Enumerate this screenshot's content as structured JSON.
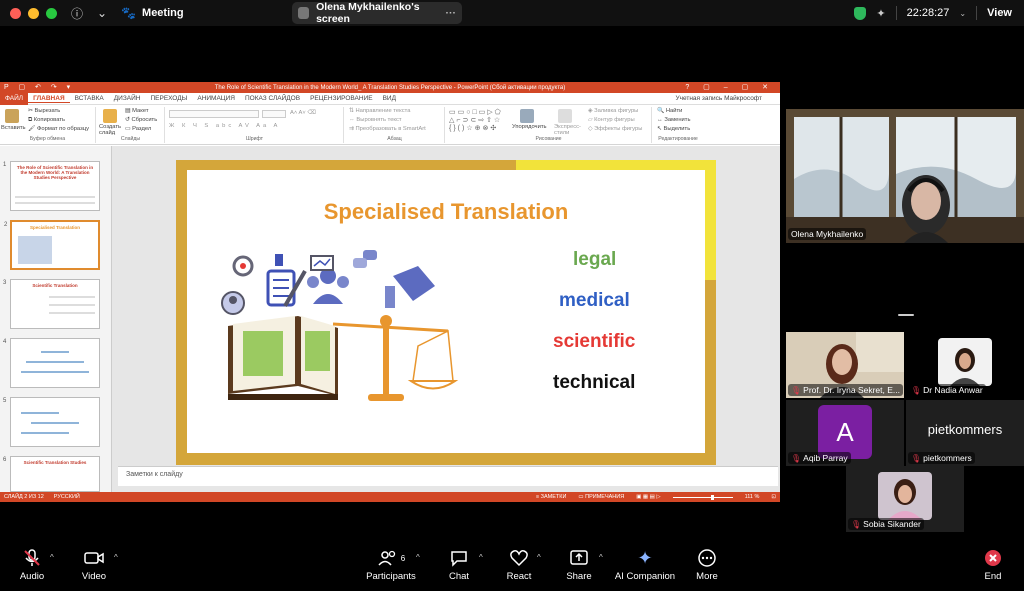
{
  "topbar": {
    "meeting_label": "Meeting",
    "share_title": "Olena Mykhailenko's screen",
    "clock": "22:28:27",
    "view_label": "View"
  },
  "ppt": {
    "window_title": "The Role of Scientific Translation in the Modern World_ A Translation Studies Perspective  -  PowerPoint (Сбой активации продукта)",
    "tabs": [
      "ФАЙЛ",
      "ГЛАВНАЯ",
      "ВСТАВКА",
      "ДИЗАЙН",
      "ПЕРЕХОДЫ",
      "АНИМАЦИЯ",
      "ПОКАЗ СЛАЙДОВ",
      "РЕЦЕНЗИРОВАНИЕ",
      "ВИД"
    ],
    "account": "Учетная запись Майкрософт",
    "ribbon": {
      "paste": "Вставить",
      "cut": "Вырезать",
      "copy": "Копировать",
      "format_painter": "Формат по образцу",
      "clipboard": "Буфер обмена",
      "create_slide": "Создать слайд",
      "layout": "Макет",
      "reset": "Сбросить",
      "section": "Раздел",
      "slides": "Слайды",
      "font": "Шрифт",
      "text_direction": "Направление текста",
      "align_text": "Выровнять текст",
      "smartart": "Преобразовать в SmartArt",
      "paragraph": "Абзац",
      "arrange": "Упорядочить",
      "quick_styles": "Экспресс-стили",
      "shape_fill": "Заливка фигуры",
      "shape_outline": "Контур фигуры",
      "shape_effects": "Эффекты фигуры",
      "drawing": "Рисование",
      "find": "Найти",
      "replace": "Заменить",
      "select": "Выделить",
      "editing": "Редактирование"
    },
    "thumbnails": [
      {
        "num": "1",
        "title": "The Role of Scientific Translation in the Modern World: A Translation Studies Perspective"
      },
      {
        "num": "2",
        "title": "Specialised Translation"
      },
      {
        "num": "3",
        "title": "Scientific Translation"
      },
      {
        "num": "4",
        "title": ""
      },
      {
        "num": "5",
        "title": ""
      },
      {
        "num": "6",
        "title": "Scientific Translation Studies"
      }
    ],
    "slide": {
      "title": "Specialised Translation",
      "words": [
        {
          "text": "legal",
          "color": "#6aa84f"
        },
        {
          "text": "medical",
          "color": "#2f5fc4"
        },
        {
          "text": "scientific",
          "color": "#e53935"
        },
        {
          "text": "technical",
          "color": "#111111"
        }
      ]
    },
    "notes_placeholder": "Заметки к слайду",
    "status": {
      "slide_of": "СЛАЙД 2 ИЗ 12",
      "language": "РУССКИЙ",
      "notes": "ЗАМЕТКИ",
      "comments": "ПРИМЕЧАНИЯ",
      "zoom": "111 %"
    }
  },
  "participants_panel": {
    "active_speaker": "Olena Mykhailenko",
    "tiles": [
      {
        "name": "Prof. Dr. Iryna Sekret, E...",
        "muted": true
      },
      {
        "name": "Dr Nadia Anwar",
        "muted": true
      },
      {
        "name": "Aqib Parray",
        "muted": true,
        "avatar_letter": "A",
        "avatar_color": "#7b1fa2"
      },
      {
        "name": "pietkommers",
        "muted": true,
        "display_text": "pietkommers"
      },
      {
        "name": "Sobia Sikander",
        "muted": true
      }
    ]
  },
  "toolbar": {
    "audio": "Audio",
    "video": "Video",
    "participants": "Participants",
    "participants_count": "6",
    "chat": "Chat",
    "react": "React",
    "share": "Share",
    "ai": "AI Companion",
    "more": "More",
    "end": "End"
  }
}
